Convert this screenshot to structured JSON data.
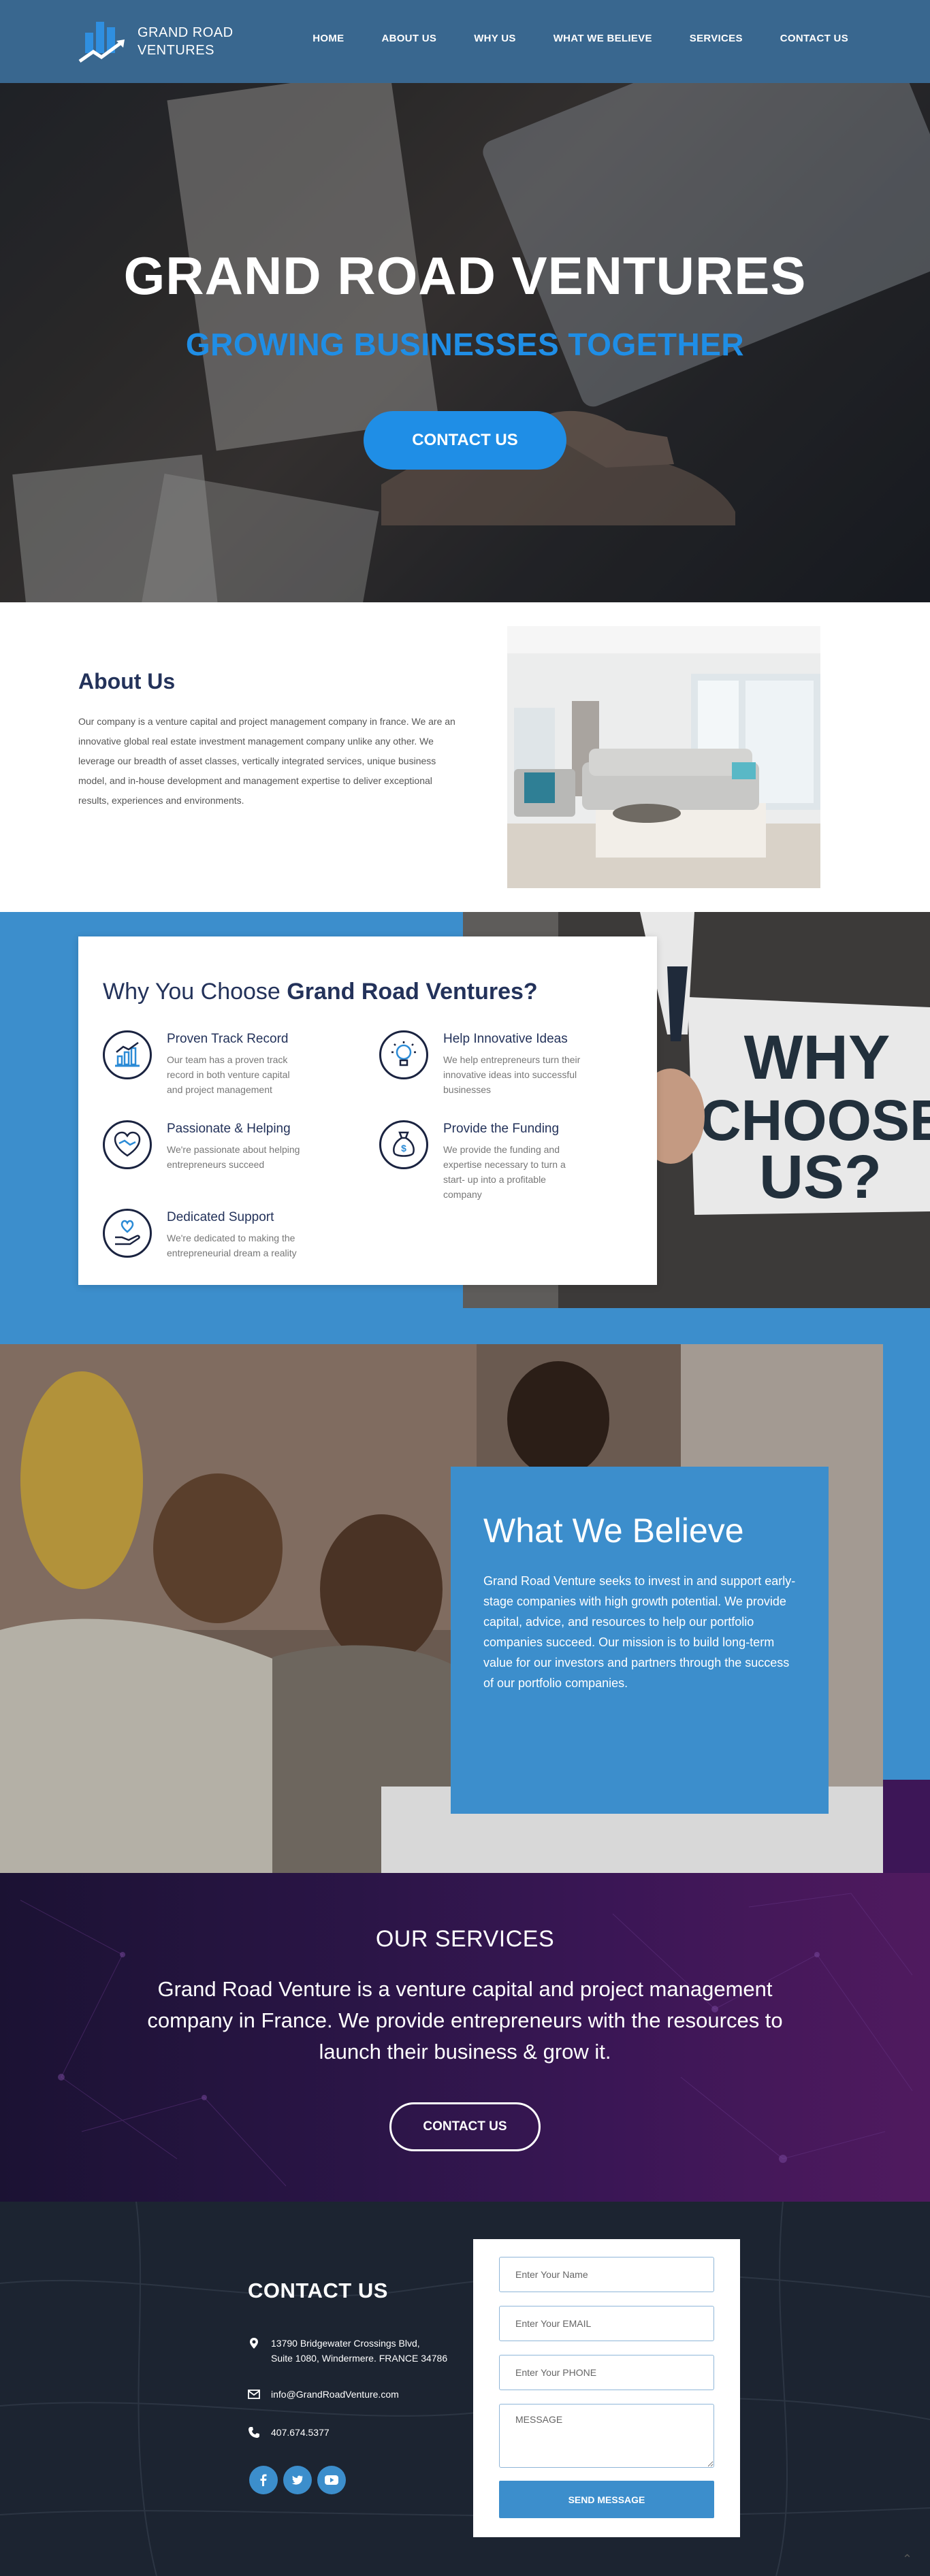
{
  "header": {
    "logo_text": "GRAND ROAD VENTURES",
    "logo_line1": "GRAND ROAD",
    "logo_line2": "VENTURES",
    "nav": [
      "HOME",
      "ABOUT US",
      "WHY US",
      "WHAT WE BELIEVE",
      "SERVICES",
      "CONTACT US"
    ]
  },
  "hero": {
    "title": "GRAND ROAD VENTURES",
    "subtitle": "GROWING BUSINESSES TOGETHER",
    "button": "CONTACT US"
  },
  "about": {
    "heading": "About Us",
    "body": "Our company is a venture capital and project management company in france. We are an innovative global real estate investment management company unlike any other. We leverage our breadth of asset classes, vertically integrated services, unique business model, and in-house development and management expertise to deliver exceptional results, experiences and environments."
  },
  "why": {
    "heading_plain": "Why You Choose ",
    "heading_bold": "Grand Road Ventures?",
    "sign_text": [
      "WHY",
      "CHOOSE",
      "US?"
    ],
    "items": [
      {
        "title": "Proven Track Record",
        "text": "Our team has a proven track record in both venture capital and project management",
        "icon": "chart-icon"
      },
      {
        "title": "Help Innovative Ideas",
        "text": "We help entrepreneurs turn their innovative ideas into successful businesses",
        "icon": "lightbulb-icon"
      },
      {
        "title": "Passionate & Helping",
        "text": "We're passionate about helping entrepreneurs succeed",
        "icon": "handshake-icon"
      },
      {
        "title": "Provide the Funding",
        "text": "We provide the funding and expertise necessary to turn a start- up into a profitable company",
        "icon": "money-bag-icon"
      },
      {
        "title": "Dedicated Support",
        "text": "We're dedicated to making the entrepreneurial dream a reality",
        "icon": "support-hand-icon"
      }
    ]
  },
  "believe": {
    "heading": "What We Believe",
    "body": "Grand Road Venture seeks to invest in and support early-stage companies with high growth potential. We provide capital, advice, and resources to help our portfolio companies succeed. Our mission is to build long-term value for our investors and partners through the success of our portfolio companies."
  },
  "services": {
    "heading": "OUR SERVICES",
    "body": "Grand Road Venture is a venture capital and project management company in France. We provide entrepreneurs with the resources to launch their business & grow it.",
    "button": "CONTACT US"
  },
  "contact": {
    "heading": "CONTACT US",
    "address_line1": "13790 Bridgewater Crossings Blvd,",
    "address_line2": "Suite 1080, Windermere. FRANCE 34786",
    "email": "info@GrandRoadVenture.com",
    "phone": "407.674.5377",
    "form": {
      "name_placeholder": "Enter Your Name",
      "email_placeholder": "Enter Your EMAIL",
      "phone_placeholder": "Enter Your PHONE",
      "message_placeholder": "MESSAGE",
      "submit": "SEND MESSAGE"
    },
    "socials": [
      "facebook-icon",
      "twitter-icon",
      "youtube-icon"
    ]
  },
  "colors": {
    "header_bg": "#39678f",
    "accent_blue": "#1f8ee6",
    "section_blue": "#3c8ecc",
    "navy_text": "#23325a",
    "services_purple": "#2b1547",
    "footer_dark": "#1c2431"
  }
}
